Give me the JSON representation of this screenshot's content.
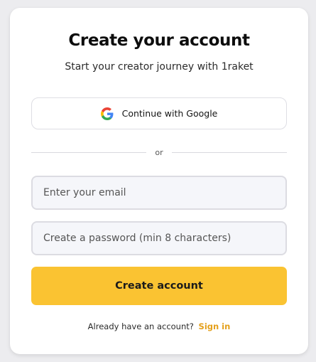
{
  "signup": {
    "title": "Create your account",
    "subtitle": "Start your creator journey with 1raket",
    "google_button": {
      "label": "Continue with Google",
      "icon": "google-g-icon"
    },
    "divider_text": "or",
    "email_field": {
      "placeholder": "Enter your email",
      "value": ""
    },
    "password_field": {
      "placeholder": "Create a password (min 8 characters)",
      "value": ""
    },
    "submit_button": {
      "label": "Create account"
    },
    "footer": {
      "prompt": "Already have an account?",
      "link": "Sign in"
    }
  },
  "colors": {
    "accent": "#fac332",
    "link": "#e4a01c",
    "field_bg": "#f5f6fa",
    "card_bg": "#ffffff"
  }
}
